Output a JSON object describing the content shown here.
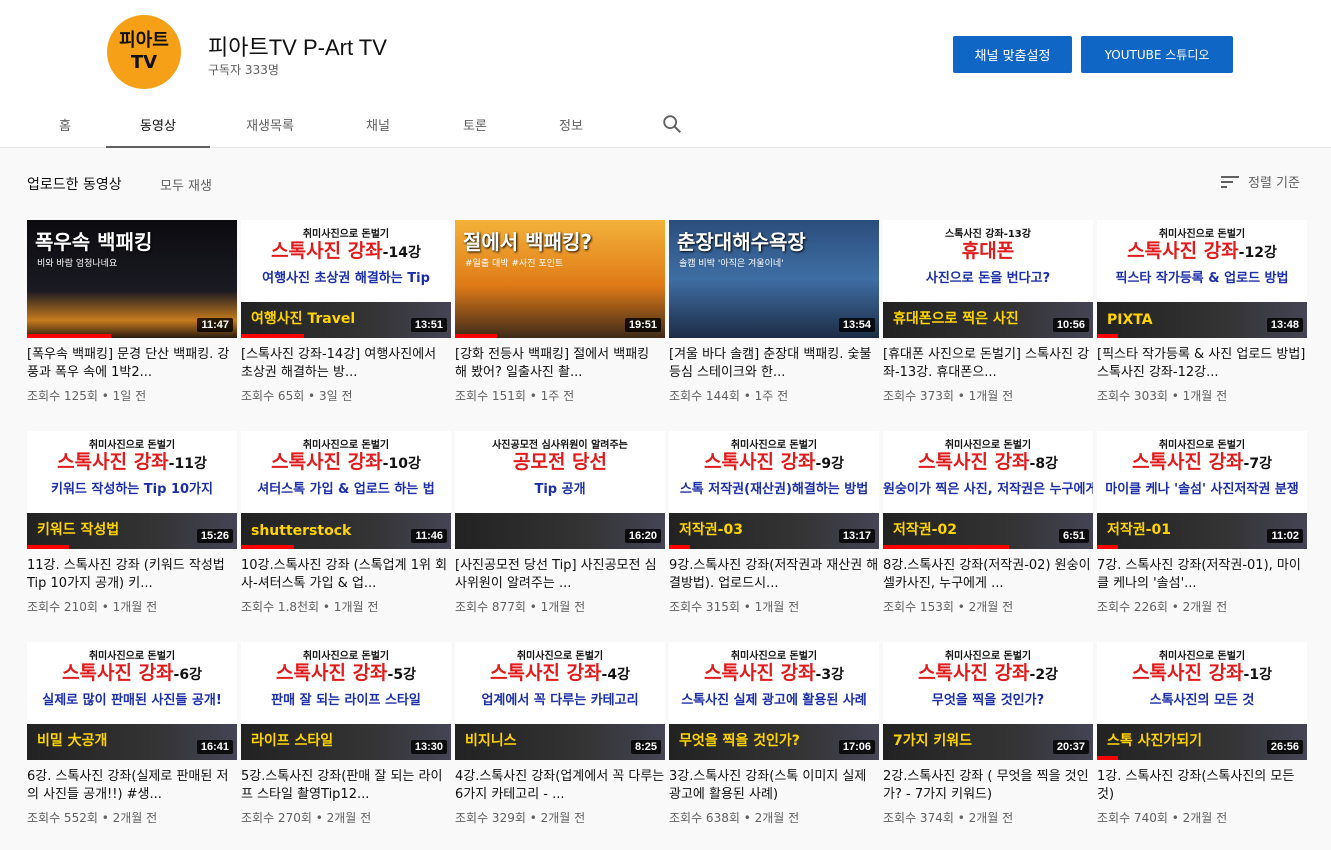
{
  "channel": {
    "avatar_line1": "피아트",
    "avatar_line2": "TV",
    "name": "피아트TV P-Art TV",
    "subscribers": "구독자 333명",
    "customize_label": "채널 맞춤설정",
    "studio_label": "YOUTUBE 스튜디오"
  },
  "tabs": [
    {
      "label": "홈"
    },
    {
      "label": "동영상"
    },
    {
      "label": "재생목록"
    },
    {
      "label": "채널"
    },
    {
      "label": "토론"
    },
    {
      "label": "정보"
    }
  ],
  "section": {
    "title": "업로드한 동영상",
    "play_all": "모두 재생",
    "sort_label": "정렬 기준"
  },
  "colors": {
    "accent_blue": "#0f66c4",
    "progress_red": "#ff0000",
    "avatar_orange": "#f5a017"
  },
  "videos": [
    {
      "thumb": "photo",
      "thumb_title": "폭우속 백패킹",
      "thumb_sub": "비와 바람 엄청나네요",
      "duration": "11:47",
      "title": "[폭우속 백패킹] 문경 단산 백패킹. 강풍과 폭우 속에 1박2...",
      "meta": "조회수 125회 • 1일 전",
      "progress": 0.4
    },
    {
      "thumb": "lecture",
      "thumb_top": "취미사진으로 돈벌기",
      "thumb_main": "스톡사진 강좌",
      "thumb_suffix": "-14강",
      "thumb_sub": "여행사진 초상권 해결하는 Tip",
      "thumb_strip": "여행사진 Travel",
      "duration": "13:51",
      "title": "[스톡사진 강좌-14강] 여행사진에서 초상권 해결하는 방...",
      "meta": "조회수 65회 • 3일 전",
      "progress": 0.3
    },
    {
      "thumb": "photo",
      "thumb_title": "절에서 백패킹?",
      "thumb_sub": "#일출 대박 #사진 포인트",
      "duration": "19:51",
      "title": "[강화 전등사 백패킹] 절에서 백패킹 해 봤어? 일출사진 촬...",
      "meta": "조회수 151회 • 1주 전",
      "progress": 0.2
    },
    {
      "thumb": "photo",
      "thumb_title": "춘장대해수욕장",
      "thumb_sub": "솔캠 비박 '아직은 겨울이네'",
      "duration": "13:54",
      "title": "[겨울 바다 솔캠] 춘장대 백패킹. 숯불 등심 스테이크와 한...",
      "meta": "조회수 144회 • 1주 전",
      "progress": 0.0
    },
    {
      "thumb": "lecture",
      "thumb_top": "스톡사진 강좌-13강",
      "thumb_main": "휴대폰",
      "thumb_suffix": "",
      "thumb_sub": "사진으로 돈을 번다고?",
      "thumb_strip": "휴대폰으로 찍은 사진",
      "duration": "10:56",
      "title": "[휴대폰 사진으로 돈벌기] 스톡사진 강좌-13강. 휴대폰으...",
      "meta": "조회수 373회 • 1개월 전",
      "progress": 0.0
    },
    {
      "thumb": "lecture",
      "thumb_top": "취미사진으로 돈벌기",
      "thumb_main": "스톡사진 강좌",
      "thumb_suffix": "-12강",
      "thumb_sub": "픽스타 작가등록 & 업로드 방법",
      "thumb_strip": "PIXTA",
      "duration": "13:48",
      "title": "[픽스타 작가등록 & 사진 업로드 방법] 스톡사진 강좌-12강...",
      "meta": "조회수 303회 • 1개월 전",
      "progress": 0.1
    },
    {
      "thumb": "lecture",
      "thumb_top": "취미사진으로 돈벌기",
      "thumb_main": "스톡사진 강좌",
      "thumb_suffix": "-11강",
      "thumb_sub": "키워드 작성하는 Tip 10가지",
      "thumb_strip": "키워드 작성법",
      "duration": "15:26",
      "title": "11강. 스톡사진 강좌 (키워드 작성법 Tip 10가지 공개) 키...",
      "meta": "조회수 210회 • 1개월 전",
      "progress": 0.2
    },
    {
      "thumb": "lecture",
      "thumb_top": "취미사진으로 돈벌기",
      "thumb_main": "스톡사진 강좌",
      "thumb_suffix": "-10강",
      "thumb_sub": "셔터스톡 가입 & 업로드 하는 법",
      "thumb_strip": "shutterstock",
      "duration": "11:46",
      "title": "10강.스톡사진 강좌 (스톡업계 1위 회사-셔터스톡 가입 & 업...",
      "meta": "조회수 1.8천회 • 1개월 전",
      "progress": 0.25
    },
    {
      "thumb": "lecture",
      "thumb_top": "사진공모전 심사위원이 알려주는",
      "thumb_main": "공모전 당선",
      "thumb_suffix": "",
      "thumb_sub": "Tip 공개",
      "thumb_strip": "",
      "duration": "16:20",
      "title": "[사진공모전 당선 Tip] 사진공모전 심사위원이 알려주는 ...",
      "meta": "조회수 877회 • 1개월 전",
      "progress": 0.0
    },
    {
      "thumb": "lecture",
      "thumb_top": "취미사진으로 돈벌기",
      "thumb_main": "스톡사진 강좌",
      "thumb_suffix": "-9강",
      "thumb_sub": "스톡 저작권(재산권)해결하는 방법",
      "thumb_strip": "저작권-03",
      "duration": "13:17",
      "title": "9강.스톡사진 강좌(저작권과 재산권 해결방법). 업로드시...",
      "meta": "조회수 315회 • 1개월 전",
      "progress": 0.1
    },
    {
      "thumb": "lecture",
      "thumb_top": "취미사진으로 돈벌기",
      "thumb_main": "스톡사진 강좌",
      "thumb_suffix": "-8강",
      "thumb_sub": "원숭이가 찍은 사진, 저작권은 누구에게?",
      "thumb_strip": "저작권-02",
      "duration": "6:51",
      "title": "8강.스톡사진 강좌(저작권-02) 원숭이 셀카사진, 누구에게 ...",
      "meta": "조회수 153회 • 2개월 전",
      "progress": 0.6
    },
    {
      "thumb": "lecture",
      "thumb_top": "취미사진으로 돈벌기",
      "thumb_main": "스톡사진 강좌",
      "thumb_suffix": "-7강",
      "thumb_sub": "마이클 케나 '솔섬' 사진저작권 분쟁",
      "thumb_strip": "저작권-01",
      "duration": "11:02",
      "title": "7강. 스톡사진 강좌(저작권-01), 마이클 케나의 '솔섬'...",
      "meta": "조회수 226회 • 2개월 전",
      "progress": 0.1
    },
    {
      "thumb": "lecture",
      "thumb_top": "취미사진으로 돈벌기",
      "thumb_main": "스톡사진 강좌",
      "thumb_suffix": "-6강",
      "thumb_sub": "실제로 많이 판매된 사진들 공개!",
      "thumb_strip": "비밀 大공개",
      "duration": "16:41",
      "title": "6강. 스톡사진 강좌(실제로 판매된 저의 사진들 공개!!) #생...",
      "meta": "조회수 552회 • 2개월 전",
      "progress": 0.0
    },
    {
      "thumb": "lecture",
      "thumb_top": "취미사진으로 돈벌기",
      "thumb_main": "스톡사진 강좌",
      "thumb_suffix": "-5강",
      "thumb_sub": "판매 잘 되는 라이프 스타일",
      "thumb_strip": "라이프 스타일",
      "duration": "13:30",
      "title": "5강.스톡사진 강좌(판매 잘 되는 라이프 스타일 촬영Tip12...",
      "meta": "조회수 270회 • 2개월 전",
      "progress": 0.0
    },
    {
      "thumb": "lecture",
      "thumb_top": "취미사진으로 돈벌기",
      "thumb_main": "스톡사진 강좌",
      "thumb_suffix": "-4강",
      "thumb_sub": "업계에서 꼭 다루는 카테고리",
      "thumb_strip": "비지니스",
      "duration": "8:25",
      "title": "4강.스톡사진 강좌(업계에서 꼭 다루는 6가지 카테고리 - ...",
      "meta": "조회수 329회 • 2개월 전",
      "progress": 0.0
    },
    {
      "thumb": "lecture",
      "thumb_top": "취미사진으로 돈벌기",
      "thumb_main": "스톡사진 강좌",
      "thumb_suffix": "-3강",
      "thumb_sub": "스톡사진 실제 광고에 활용된 사례",
      "thumb_strip": "무엇을 찍을 것인가?",
      "duration": "17:06",
      "title": "3강.스톡사진 강좌(스톡 이미지 실제 광고에 활용된 사례)",
      "meta": "조회수 638회 • 2개월 전",
      "progress": 0.0
    },
    {
      "thumb": "lecture",
      "thumb_top": "취미사진으로 돈벌기",
      "thumb_main": "스톡사진 강좌",
      "thumb_suffix": "-2강",
      "thumb_sub": "무엇을 찍을 것인가?",
      "thumb_strip": "7가지 키워드",
      "duration": "20:37",
      "title": "2강.스톡사진 강좌 ( 무엇을 찍을 것인가? - 7가지 키워드)",
      "meta": "조회수 374회 • 2개월 전",
      "progress": 0.0
    },
    {
      "thumb": "lecture",
      "thumb_top": "취미사진으로 돈벌기",
      "thumb_main": "스톡사진 강좌",
      "thumb_suffix": "-1강",
      "thumb_sub": "스톡사진의 모든 것",
      "thumb_strip": "스톡 사진가되기",
      "duration": "26:56",
      "title": "1강. 스톡사진 강좌(스톡사진의 모든 것)",
      "meta": "조회수 740회 • 2개월 전",
      "progress": 0.1
    }
  ]
}
